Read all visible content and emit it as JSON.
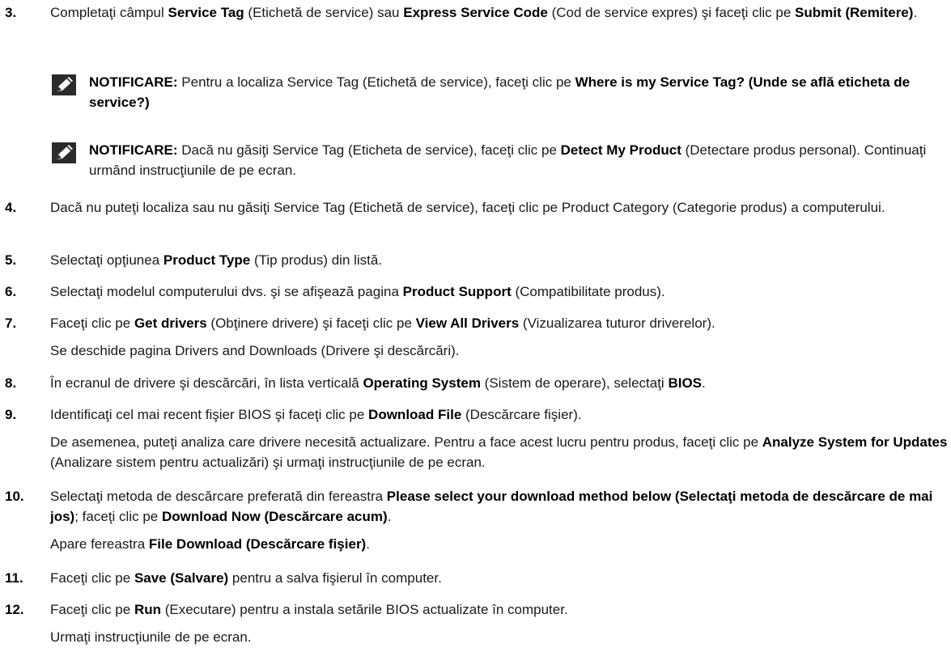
{
  "steps": [
    {
      "num": "3.",
      "parts": [
        {
          "t": "Completaţi câmpul "
        },
        {
          "t": "Service Tag",
          "b": true
        },
        {
          "t": " (Etichetă de service) sau "
        },
        {
          "t": "Express Service Code",
          "b": true
        },
        {
          "t": " (Cod de service expres) şi faceţi clic pe "
        },
        {
          "t": "Submit (Remitere)",
          "b": true
        },
        {
          "t": "."
        }
      ]
    },
    {
      "num": "4.",
      "parts": [
        {
          "t": "Dacă nu puteţi localiza sau nu găsiţi Service Tag (Etichetă de service), faceţi clic pe Product Category (Categorie produs) a computerului."
        }
      ]
    },
    {
      "num": "5.",
      "parts": [
        {
          "t": "Selectaţi opţiunea "
        },
        {
          "t": "Product Type",
          "b": true
        },
        {
          "t": " (Tip produs) din listă."
        }
      ]
    },
    {
      "num": "6.",
      "parts": [
        {
          "t": "Selectaţi modelul computerului dvs. şi se afişează pagina "
        },
        {
          "t": "Product Support",
          "b": true
        },
        {
          "t": " (Compatibilitate produs)."
        }
      ]
    },
    {
      "num": "7.",
      "parts": [
        {
          "t": "Faceţi clic pe "
        },
        {
          "t": "Get drivers",
          "b": true
        },
        {
          "t": " (Obţinere drivere) şi faceţi clic pe "
        },
        {
          "t": "View All Drivers",
          "b": true
        },
        {
          "t": " (Vizualizarea tuturor driverelor)."
        }
      ],
      "extra": [
        [
          {
            "t": "Se deschide pagina Drivers and Downloads (Drivere şi descărcări)."
          }
        ]
      ]
    },
    {
      "num": "8.",
      "parts": [
        {
          "t": "În ecranul de drivere şi descărcări, în lista verticală "
        },
        {
          "t": "Operating System",
          "b": true
        },
        {
          "t": " (Sistem de operare), selectaţi "
        },
        {
          "t": "BIOS",
          "b": true
        },
        {
          "t": "."
        }
      ]
    },
    {
      "num": "9.",
      "parts": [
        {
          "t": "Identificaţi cel mai recent fişier BIOS şi faceţi clic pe "
        },
        {
          "t": "Download File",
          "b": true
        },
        {
          "t": " (Descărcare fişier)."
        }
      ],
      "extra": [
        [
          {
            "t": "De asemenea, puteţi analiza care drivere necesită actualizare. Pentru a face acest lucru pentru produs, faceţi clic pe "
          },
          {
            "t": "Analyze System for Updates",
            "b": true
          },
          {
            "t": " (Analizare sistem pentru actualizări) şi urmaţi instrucţiunile de pe ecran."
          }
        ]
      ]
    },
    {
      "num": "10.",
      "parts": [
        {
          "t": "Selectaţi metoda de descărcare preferată din fereastra "
        },
        {
          "t": "Please select your download method below (Selectaţi metoda de descărcare de mai jos)",
          "b": true
        },
        {
          "t": "; faceţi clic pe "
        },
        {
          "t": "Download Now (Descărcare acum)",
          "b": true
        },
        {
          "t": "."
        }
      ],
      "extra": [
        [
          {
            "t": "Apare fereastra "
          },
          {
            "t": "File Download (Descărcare fişier)",
            "b": true
          },
          {
            "t": "."
          }
        ]
      ]
    },
    {
      "num": "11.",
      "parts": [
        {
          "t": "Faceţi clic pe "
        },
        {
          "t": "Save (Salvare)",
          "b": true
        },
        {
          "t": " pentru a salva fişierul în computer."
        }
      ]
    },
    {
      "num": "12.",
      "parts": [
        {
          "t": "Faceţi clic pe "
        },
        {
          "t": "Run",
          "b": true
        },
        {
          "t": " (Executare) pentru a instala setările BIOS actualizate în computer."
        }
      ],
      "extra": [
        [
          {
            "t": "Urmaţi instrucţiunile de pe ecran."
          }
        ]
      ]
    }
  ],
  "notes": [
    {
      "parts": [
        {
          "t": "NOTIFICARE:",
          "b": true
        },
        {
          "t": " Pentru a localiza Service Tag (Etichetă de service), faceţi clic pe "
        },
        {
          "t": "Where is my Service Tag? (Unde se află eticheta de service?)",
          "b": true
        }
      ]
    },
    {
      "parts": [
        {
          "t": "NOTIFICARE:",
          "b": true
        },
        {
          "t": " Dacă nu găsiţi Service Tag (Eticheta de service), faceţi clic pe "
        },
        {
          "t": "Detect My Product",
          "b": true
        },
        {
          "t": " (Detectare produs personal). Continuaţi urmând instrucţiunile de pe ecran."
        }
      ]
    }
  ],
  "icons": {
    "note": "pencil-note-icon"
  }
}
